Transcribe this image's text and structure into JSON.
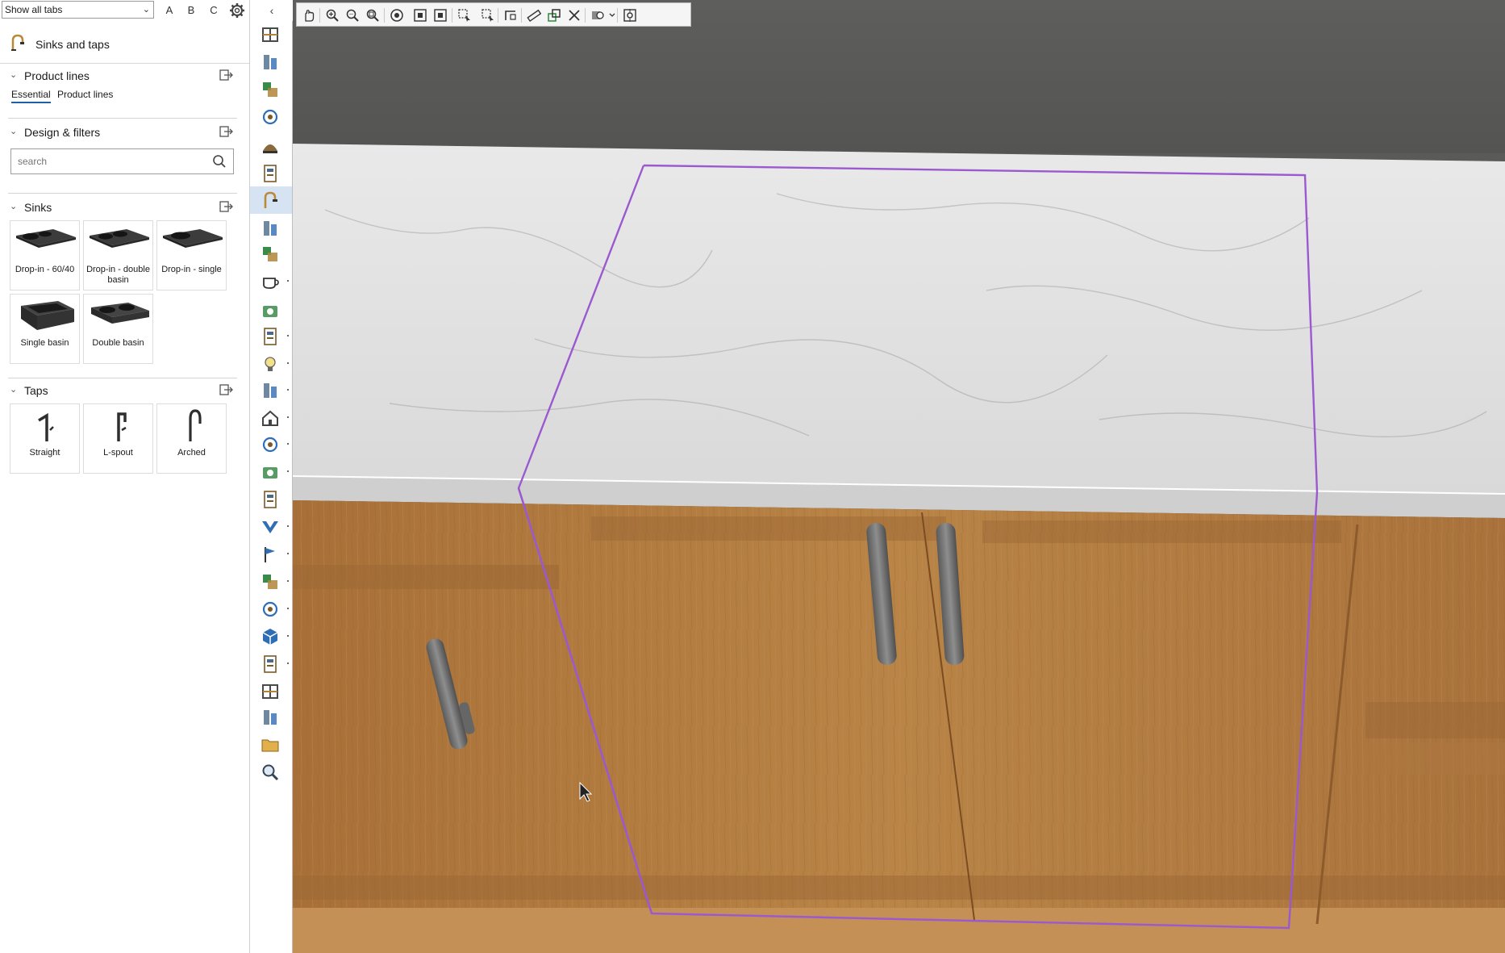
{
  "topbar": {
    "tab_select_value": "Show all tabs",
    "letters": [
      "A",
      "B",
      "C"
    ],
    "icons": [
      "settings-gear-icon",
      "collapse-panel-icon"
    ]
  },
  "category": {
    "title": "Sinks and taps",
    "icon": "sink-tap-icon"
  },
  "sections": {
    "product_lines": {
      "title": "Product lines",
      "tabs": [
        {
          "label": "Essential",
          "active": true
        },
        {
          "label": "Product lines",
          "active": false
        }
      ]
    },
    "design_filters": {
      "title": "Design & filters",
      "search_placeholder": "search"
    },
    "sinks": {
      "title": "Sinks",
      "items": [
        {
          "label": "Drop-in - 60/40"
        },
        {
          "label": "Drop-in - double basin"
        },
        {
          "label": "Drop-in - single"
        },
        {
          "label": "Single basin"
        },
        {
          "label": "Double basin"
        }
      ]
    },
    "taps": {
      "title": "Taps",
      "items": [
        {
          "label": "Straight"
        },
        {
          "label": "L-spout"
        },
        {
          "label": "Arched"
        }
      ]
    }
  },
  "icon_column": {
    "items": [
      "cooktop-icon",
      "utensils-icon",
      "floor-plan-icon",
      "wall-cabinets-icon",
      "range-hood-icon",
      "oven-icon",
      "sink-tap-icon",
      "tall-cabinets-icon",
      "appliances-icon",
      "cup-icon",
      "panels-icon",
      "decor-icon",
      "lighting-icon",
      "plants-icon",
      "home-icon",
      "lamp-icon",
      "building-icon",
      "pdf-catalog-icon",
      "brand-logo-icon",
      "flag-icon",
      "textures-icon",
      "camera-icon",
      "3d-model-icon",
      "render-icon",
      "laptop-icon",
      "pdf-report-icon",
      "folder-icon",
      "zoom-icon"
    ],
    "active": "sink-tap-icon"
  },
  "toolbar": {
    "icons": [
      "pan-hand-icon",
      "zoom-in-icon",
      "zoom-out-icon",
      "zoom-fit-icon",
      "orbit-icon",
      "fit-selection-icon",
      "frame-icon",
      "select-area-icon",
      "select-detail-icon",
      "dimension-icon",
      "measure-ruler-icon",
      "snap-icon",
      "delete-measure-icon",
      "view-mode-icon",
      "view-mode-dropdown-icon",
      "capture-icon"
    ]
  },
  "colors": {
    "selection_outline": "#9b59d0",
    "wall": "#5c5c5a",
    "worktop": "#e4e4e4",
    "cabinet_wood": "#b07a3f",
    "active_tab_underline": "#1f5fa8",
    "active_icon_bg": "#d6e3f2"
  }
}
